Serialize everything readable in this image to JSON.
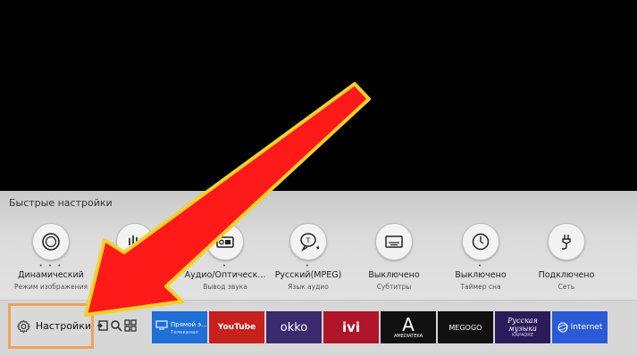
{
  "quick_settings": {
    "title": "Быстрые настройки",
    "items": [
      {
        "icon": "picture-mode-icon",
        "value": "Динамический",
        "label": "Режим изображения",
        "dots": "•  •  •"
      },
      {
        "icon": "sound-mode-icon",
        "value": "",
        "label": "",
        "dots": ""
      },
      {
        "icon": "sound-output-icon",
        "value": "Аудио/Оптическ...",
        "label": "Вывод звука",
        "dots": "•"
      },
      {
        "icon": "audio-language-icon",
        "value": "Русский(MPEG)",
        "label": "Язык аудио",
        "dots": "•"
      },
      {
        "icon": "subtitles-icon",
        "value": "Выключено",
        "label": "Субтитры",
        "dots": ""
      },
      {
        "icon": "sleep-timer-icon",
        "value": "Выключено",
        "label": "Таймер сна",
        "dots": "•"
      },
      {
        "icon": "network-icon",
        "value": "Подключено",
        "label": "Сеть",
        "dots": ""
      }
    ]
  },
  "bottom_bar": {
    "settings_label": "Настройки",
    "apps": [
      {
        "name": "Прямой э...",
        "sub": "Телеканал",
        "bg": "#1e6fd6"
      },
      {
        "name": "YouTube",
        "bg": "#c8201d"
      },
      {
        "name": "okko",
        "bg": "#3b2a6e"
      },
      {
        "name": "ivi",
        "bg": "#b0162a"
      },
      {
        "name": "A",
        "sub": "AMEDIATEKA",
        "bg": "#111111"
      },
      {
        "name": "MEGOGO",
        "bg": "#111111"
      },
      {
        "name": "Русская музыка",
        "sub": "КАРАОКЕ",
        "bg": "#2b1b5a"
      },
      {
        "name": "Internet",
        "bg": "#2a5bd7"
      }
    ]
  },
  "colors": {
    "highlight": "#f0a257",
    "arrow": "#ff1a1a",
    "arrow_outline": "#f2d12a"
  }
}
